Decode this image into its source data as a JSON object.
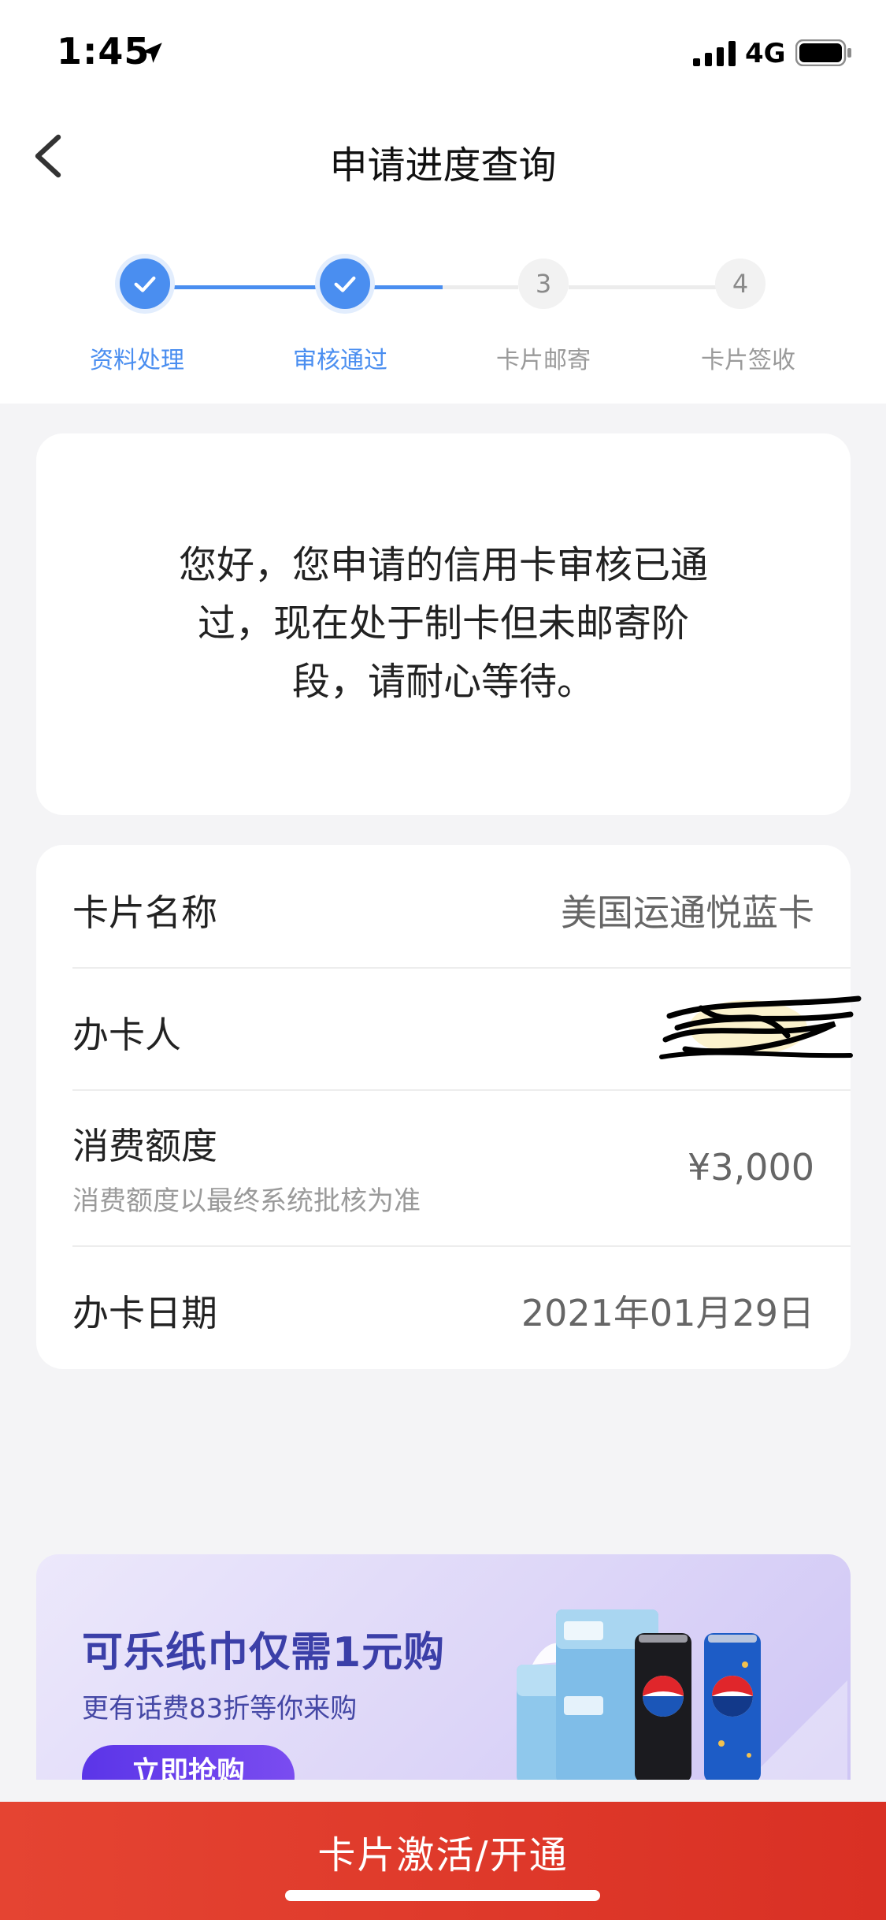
{
  "status_bar": {
    "time": "1:45",
    "network": "4G",
    "icons": [
      "location-arrow-icon",
      "signal-bars-icon",
      "battery-icon"
    ]
  },
  "nav": {
    "title": "申请进度查询",
    "back_icon": "chevron-left-icon"
  },
  "steps": [
    {
      "label": "资料处理",
      "status": "done",
      "icon": "check-icon"
    },
    {
      "label": "审核通过",
      "status": "done",
      "icon": "check-icon"
    },
    {
      "label": "卡片邮寄",
      "status": "todo",
      "number": "3"
    },
    {
      "label": "卡片签收",
      "status": "todo",
      "number": "4"
    }
  ],
  "message": {
    "lines": [
      "您好，您申请的信用卡审核已通",
      "过，现在处于制卡但未邮寄阶",
      "段，请耐心等待。"
    ]
  },
  "details": {
    "card_name": {
      "label": "卡片名称",
      "value": "美国运通悦蓝卡"
    },
    "applicant": {
      "label": "办卡人",
      "value_redacted": true
    },
    "credit_limit": {
      "label": "消费额度",
      "sublabel": "消费额度以最终系统批核为准",
      "value": "¥3,000"
    },
    "apply_date": {
      "label": "办卡日期",
      "value": "2021年01月29日"
    }
  },
  "banner": {
    "title": "可乐纸巾仅需1元购",
    "subtitle": "更有话费83折等你来购",
    "button": "立即抢购"
  },
  "bottom_button": {
    "label": "卡片激活/开通"
  },
  "colors": {
    "accent_blue": "#4a8ef0",
    "cta_red": "#e54432",
    "banner_purple": "#3b3fa8"
  }
}
